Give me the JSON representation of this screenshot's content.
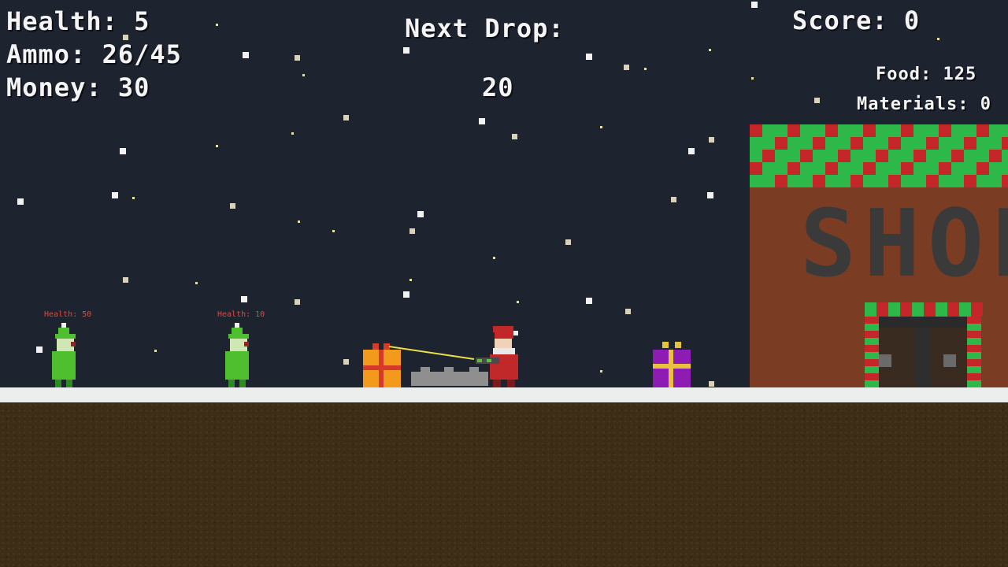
{
  "hud": {
    "health": "Health: 5",
    "ammo": "Ammo: 26/45",
    "money": "Money: 30",
    "next_drop_label": "Next Drop:",
    "next_drop_value": "20",
    "score": "Score: 0",
    "food": "Food: 125",
    "materials": "Materials: 0"
  },
  "enemies": [
    {
      "label": "Health: 50"
    },
    {
      "label": "Health: 10"
    }
  ],
  "shop": {
    "sign": "SHOP"
  },
  "colors": {
    "sky": "#1e2330",
    "elf_green": "#4fbf2f",
    "santa_red": "#c0282a",
    "gift_orange": "#f39a1c",
    "gift_purple": "#8e1cb4",
    "shop_brick": "#7a3d24",
    "roof_green": "#2fb84a",
    "roof_red": "#c5262a"
  }
}
